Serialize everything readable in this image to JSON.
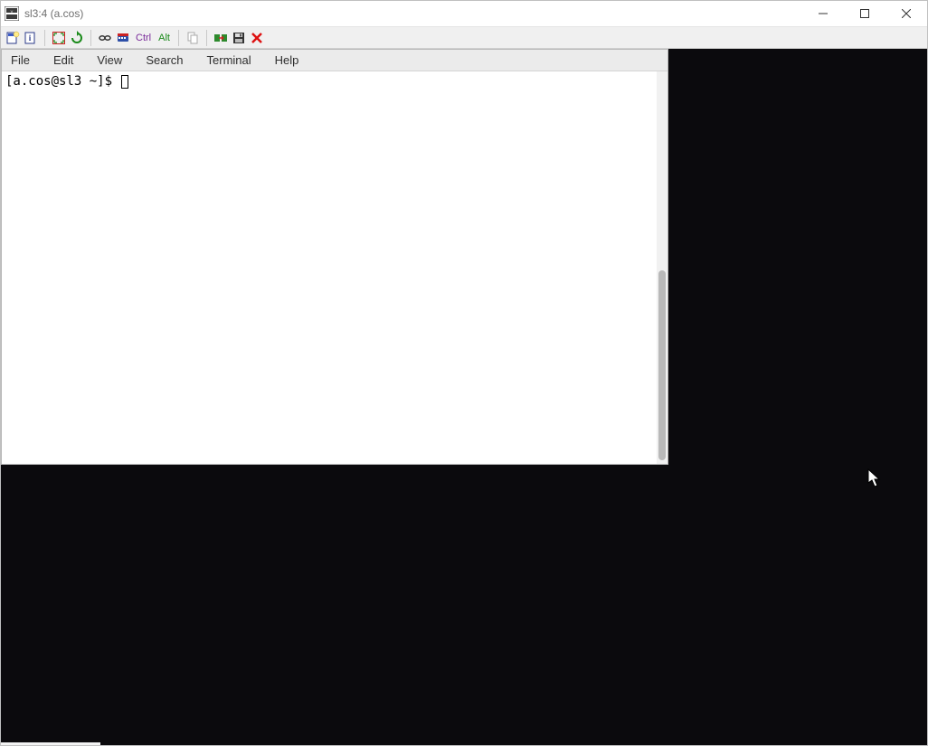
{
  "window": {
    "title": "sl3:4 (a.cos)"
  },
  "toolbar": {
    "ctrl_label": "Ctrl",
    "alt_label": "Alt"
  },
  "terminal": {
    "menu": {
      "file": "File",
      "edit": "Edit",
      "view": "View",
      "search": "Search",
      "terminal": "Terminal",
      "help": "Help"
    },
    "prompt": "[a.cos@sl3 ~]$ "
  }
}
